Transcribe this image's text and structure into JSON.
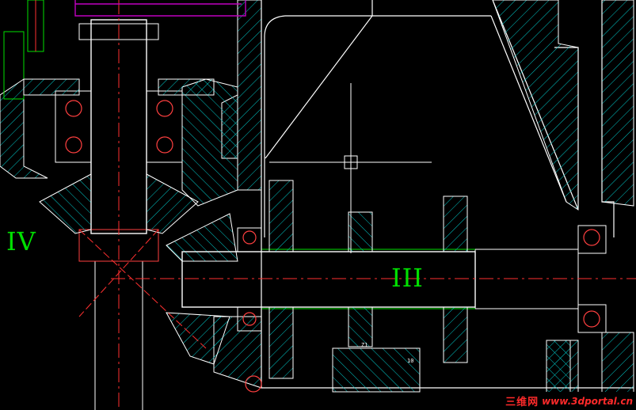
{
  "labels": {
    "shaft_iv": "IV",
    "shaft_iii": "III",
    "gear_tag_z1": "Z1",
    "gear_tag_10": "10"
  },
  "watermark": {
    "name": "三维网",
    "url": "www.3dportal.cn"
  },
  "colors": {
    "background": "#000000",
    "outline": "#ffffff",
    "hatch": "#00c8c8",
    "centerline": "#ff3030",
    "bearing": "#ff4040",
    "thread": "#00e000",
    "frame": "#c000c0",
    "label": "#00e000",
    "watermark": "#ff2a2a"
  }
}
